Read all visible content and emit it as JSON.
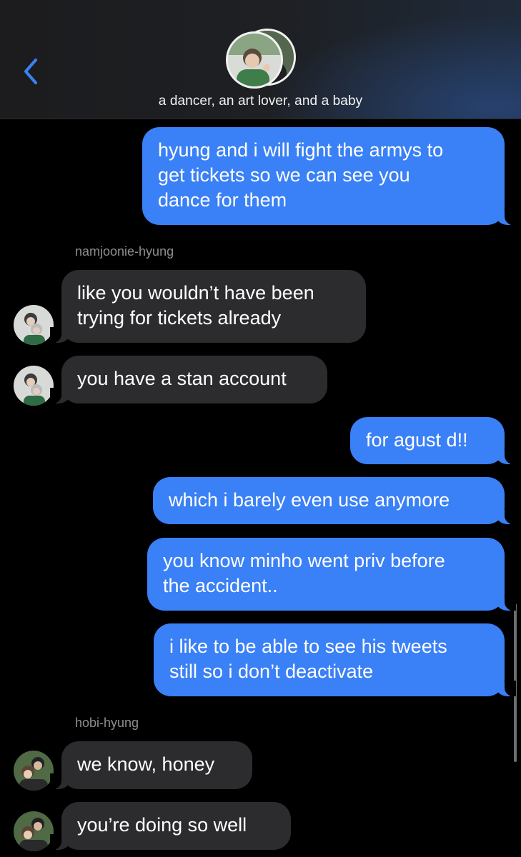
{
  "header": {
    "back_icon": "chevron-left-icon",
    "group_name": "a dancer, an art lover, and a baby",
    "accent_color": "#3a82f6"
  },
  "messages": [
    {
      "side": "outgoing",
      "text": "hyung and i will fight the armys to get tickets so we can see you dance for them",
      "lines": [
        "hyung and i will fight the armys to",
        "get tickets so we can see you",
        "dance for them"
      ]
    },
    {
      "side": "incoming",
      "sender": "namjoonie-hyung",
      "lines": [
        "like you wouldn’t have been",
        "trying for tickets already"
      ]
    },
    {
      "side": "incoming",
      "sender": "namjoonie-hyung",
      "lines": [
        "you have a stan account"
      ]
    },
    {
      "side": "outgoing",
      "lines": [
        "for agust d!!"
      ]
    },
    {
      "side": "outgoing",
      "lines": [
        "which i barely even use anymore"
      ]
    },
    {
      "side": "outgoing",
      "lines": [
        "you know minho went priv before",
        "the accident.."
      ]
    },
    {
      "side": "outgoing",
      "lines": [
        "i like to be able to see his tweets",
        "still so i don’t deactivate"
      ]
    },
    {
      "side": "incoming",
      "sender": "hobi-hyung",
      "lines": [
        "we know, honey"
      ]
    },
    {
      "side": "incoming",
      "sender": "hobi-hyung",
      "lines": [
        "you’re doing so well"
      ]
    }
  ],
  "sender_labels": {
    "first": "namjoonie-hyung",
    "second": "hobi-hyung"
  },
  "colors": {
    "outgoing_bubble": "#3a80f6",
    "incoming_bubble": "#2c2c2e",
    "background": "#000000",
    "sender_label": "#8e8e93"
  }
}
